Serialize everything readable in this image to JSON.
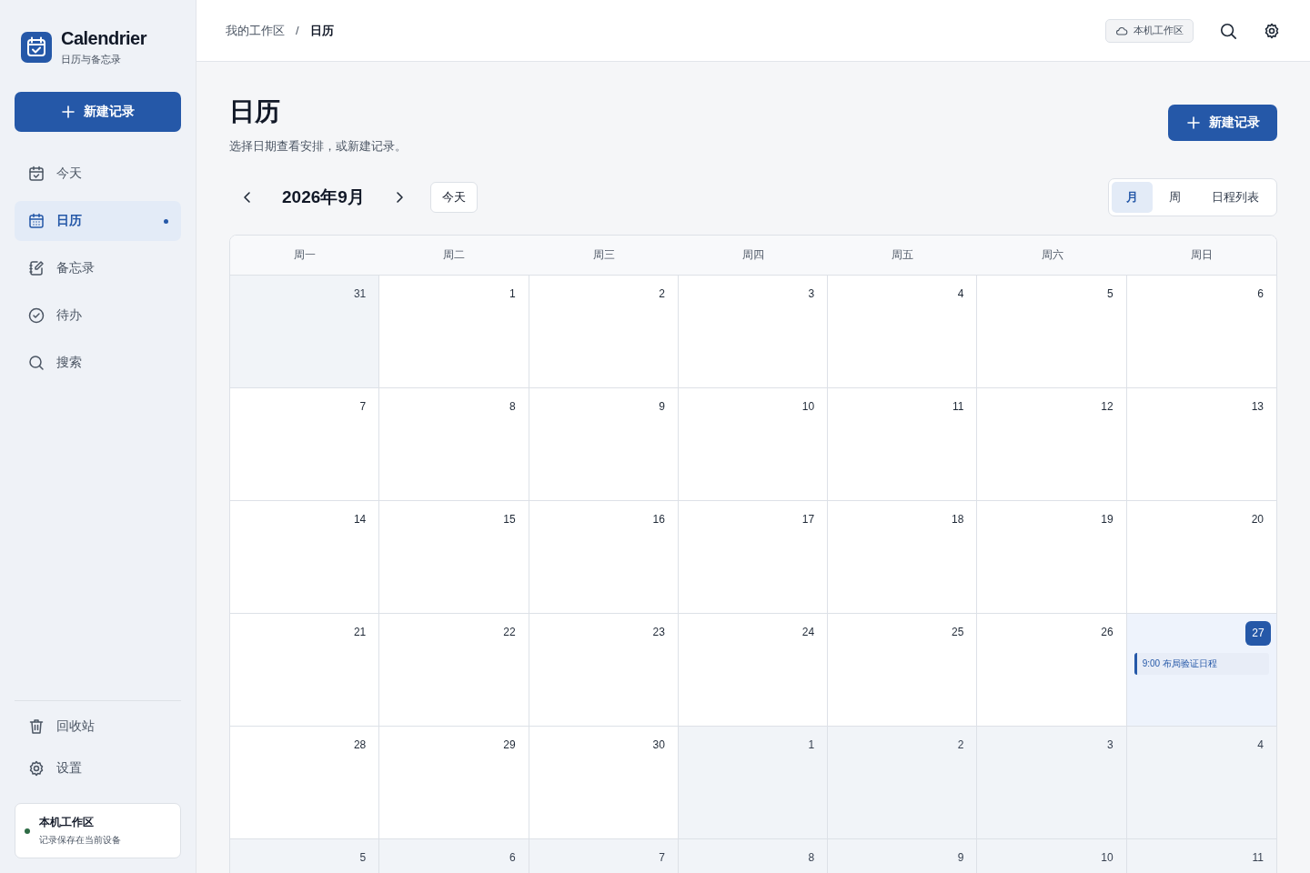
{
  "app": {
    "name": "Calendrier",
    "subtitle": "日历与备忘录"
  },
  "sidebar": {
    "new_button": "新建记录",
    "items": [
      {
        "label": "今天",
        "selected": false
      },
      {
        "label": "日历",
        "selected": true
      },
      {
        "label": "备忘录",
        "selected": false
      },
      {
        "label": "待办",
        "selected": false
      },
      {
        "label": "搜索",
        "selected": false
      }
    ],
    "bottom_items": [
      {
        "label": "回收站"
      },
      {
        "label": "设置"
      }
    ],
    "workspace": {
      "title": "本机工作区",
      "note": "记录保存在当前设备",
      "color": "#2e6b45"
    }
  },
  "breadcrumb": [
    "我的工作区",
    "日历"
  ],
  "breadcrumb_separator": "/",
  "workspace_badge": "本机工作区",
  "page": {
    "title": "日历",
    "subtitle": "选择日期查看安排，或新建记录。",
    "new_button": "新建记录"
  },
  "calendar": {
    "month": "2026年9月",
    "today_button": "今天",
    "views": [
      {
        "label": "月",
        "selected": true
      },
      {
        "label": "周",
        "selected": false
      },
      {
        "label": "日程列表",
        "selected": false
      }
    ],
    "weekdays": [
      "周一",
      "周二",
      "周三",
      "周四",
      "周五",
      "周六",
      "周日"
    ],
    "weeks": [
      [
        {
          "day": "31",
          "in_month": false,
          "today": false
        },
        {
          "day": "1",
          "in_month": true,
          "today": false
        },
        {
          "day": "2",
          "in_month": true,
          "today": false
        },
        {
          "day": "3",
          "in_month": true,
          "today": false
        },
        {
          "day": "4",
          "in_month": true,
          "today": false
        },
        {
          "day": "5",
          "in_month": true,
          "today": false
        },
        {
          "day": "6",
          "in_month": true,
          "today": false
        }
      ],
      [
        {
          "day": "7",
          "in_month": true,
          "today": false
        },
        {
          "day": "8",
          "in_month": true,
          "today": false
        },
        {
          "day": "9",
          "in_month": true,
          "today": false
        },
        {
          "day": "10",
          "in_month": true,
          "today": false
        },
        {
          "day": "11",
          "in_month": true,
          "today": false
        },
        {
          "day": "12",
          "in_month": true,
          "today": false
        },
        {
          "day": "13",
          "in_month": true,
          "today": false
        }
      ],
      [
        {
          "day": "14",
          "in_month": true,
          "today": false
        },
        {
          "day": "15",
          "in_month": true,
          "today": false
        },
        {
          "day": "16",
          "in_month": true,
          "today": false
        },
        {
          "day": "17",
          "in_month": true,
          "today": false
        },
        {
          "day": "18",
          "in_month": true,
          "today": false
        },
        {
          "day": "19",
          "in_month": true,
          "today": false
        },
        {
          "day": "20",
          "in_month": true,
          "today": false
        }
      ],
      [
        {
          "day": "21",
          "in_month": true,
          "today": false
        },
        {
          "day": "22",
          "in_month": true,
          "today": false
        },
        {
          "day": "23",
          "in_month": true,
          "today": false
        },
        {
          "day": "24",
          "in_month": true,
          "today": false
        },
        {
          "day": "25",
          "in_month": true,
          "today": false
        },
        {
          "day": "26",
          "in_month": true,
          "today": false
        },
        {
          "day": "27",
          "in_month": true,
          "today": true,
          "events": [
            {
              "time": "9:00",
              "title": "布局验证日程"
            }
          ]
        }
      ],
      [
        {
          "day": "28",
          "in_month": true,
          "today": false
        },
        {
          "day": "29",
          "in_month": true,
          "today": false
        },
        {
          "day": "30",
          "in_month": true,
          "today": false
        },
        {
          "day": "1",
          "in_month": false,
          "today": false
        },
        {
          "day": "2",
          "in_month": false,
          "today": false
        },
        {
          "day": "3",
          "in_month": false,
          "today": false
        },
        {
          "day": "4",
          "in_month": false,
          "today": false
        }
      ],
      [
        {
          "day": "5",
          "in_month": false,
          "today": false
        },
        {
          "day": "6",
          "in_month": false,
          "today": false
        },
        {
          "day": "7",
          "in_month": false,
          "today": false
        },
        {
          "day": "8",
          "in_month": false,
          "today": false
        },
        {
          "day": "9",
          "in_month": false,
          "today": false
        },
        {
          "day": "10",
          "in_month": false,
          "today": false
        },
        {
          "day": "11",
          "in_month": false,
          "today": false
        }
      ]
    ]
  }
}
